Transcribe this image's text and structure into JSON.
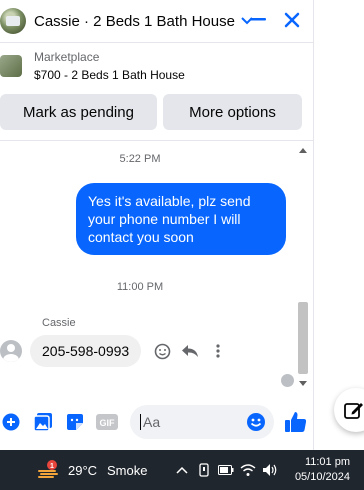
{
  "header": {
    "title": "Cassie · 2 Beds 1 Bath House",
    "accent": "#0866ff"
  },
  "marketplace": {
    "label": "Marketplace",
    "item": "$700 - 2 Beds 1 Bath House"
  },
  "actions": {
    "pending_label": "Mark as pending",
    "more_label": "More options"
  },
  "messages": {
    "timestamp_1": "5:22 PM",
    "outgoing_text": "Yes it's available, plz send your phone number I will contact you soon",
    "timestamp_2": "11:00 PM",
    "sender_name": "Cassie",
    "incoming_text": "205-598-0993"
  },
  "composer": {
    "placeholder": "Aa"
  },
  "taskbar": {
    "temperature": "29°C",
    "condition": "Smoke",
    "time": "11:01 pm",
    "date": "05/10/2024"
  }
}
